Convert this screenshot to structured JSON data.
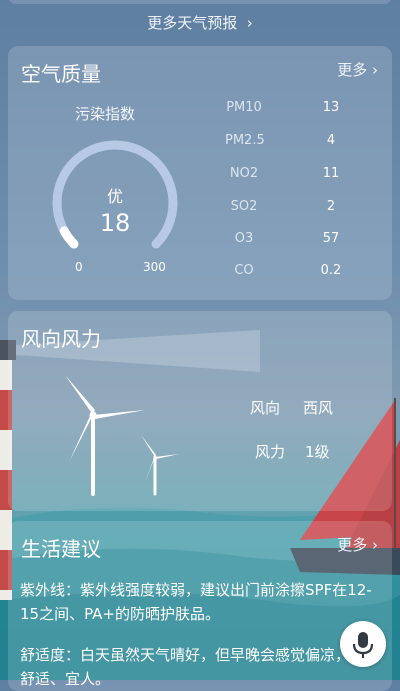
{
  "forecast_link": {
    "label": "更多天气预报",
    "chevron": "chevron-right-icon"
  },
  "air_quality": {
    "title": "空气质量",
    "more": "更多",
    "index_caption": "污染指数",
    "level": "优",
    "aqi": 18,
    "scale_min": "0",
    "scale_max": "300",
    "aqi_fraction": 0.06,
    "pollutants": [
      {
        "name": "PM10",
        "value": "13"
      },
      {
        "name": "PM2.5",
        "value": "4"
      },
      {
        "name": "NO2",
        "value": "11"
      },
      {
        "name": "SO2",
        "value": "2"
      },
      {
        "name": "O3",
        "value": "57"
      },
      {
        "name": "CO",
        "value": "0.2"
      }
    ]
  },
  "wind": {
    "title": "风向风力",
    "direction_label": "风向",
    "direction_value": "西风",
    "force_label": "风力",
    "force_value": "1级",
    "icon": "wind-turbine-icon"
  },
  "life": {
    "title": "生活建议",
    "more": "更多",
    "uv": "紫外线：紫外线强度较弱，建议出门前涂擦SPF在12-15之间、PA+的防晒护肤品。",
    "comfort": "舒适度：白天虽然天气晴好，但早晚会感觉偏凉，午后舒适、宜人。"
  },
  "mic": {
    "icon": "microphone-icon"
  },
  "colors": {
    "card_bg": "rgba(255,255,255,0.16)",
    "gauge_track": "#b8c9e6",
    "gauge_fill": "#ffffff",
    "accent_sail": "#c8454a"
  }
}
